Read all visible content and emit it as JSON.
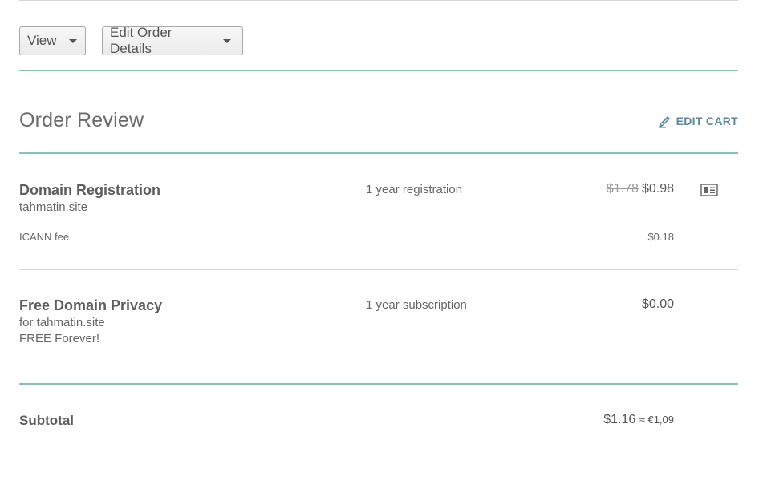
{
  "toolbar": {
    "view_label": "View",
    "edit_order_label": "Edit Order Details"
  },
  "review": {
    "title": "Order Review",
    "edit_cart_label": "EDIT CART"
  },
  "items": [
    {
      "title": "Domain Registration",
      "subtitle": "tahmatin.site",
      "term": "1 year registration",
      "old_price": "$1.78",
      "price": "$0.98",
      "icon": "contact-card-icon",
      "fee_label": "ICANN fee",
      "fee_price": "$0.18"
    },
    {
      "title": "Free Domain Privacy",
      "subtitle": "for tahmatin.site",
      "note": "FREE Forever!",
      "term": "1 year subscription",
      "price": "$0.00"
    }
  ],
  "subtotal": {
    "label": "Subtotal",
    "price": "$1.16",
    "converted": "≈ €1,09"
  },
  "colors": {
    "accent_teal": "#88c0bb",
    "link_blue": "#5a8a9c"
  }
}
